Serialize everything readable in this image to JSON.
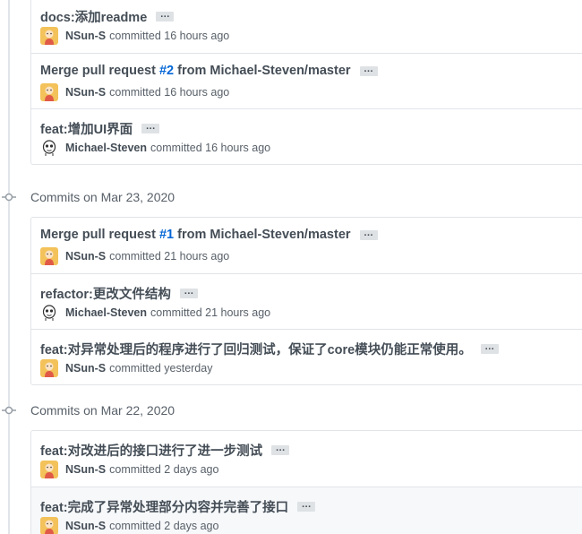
{
  "colors": {
    "accent_link": "#0366d6",
    "text_primary": "#444d56",
    "text_muted": "#586069",
    "border": "#e1e4e8",
    "ellipsis_bg": "#dfe2e5",
    "avatar_nsun_bg": "#f3c25a"
  },
  "groups": [
    {
      "title": "",
      "commits": [
        {
          "title_prefix": "docs:添加readme",
          "pr": "",
          "title_suffix": "",
          "author": "NSun-S",
          "avatar": "nsun-avatar",
          "time": "committed 16 hours ago"
        },
        {
          "title_prefix": "Merge pull request ",
          "pr": "#2",
          "title_suffix": " from Michael-Steven/master",
          "author": "NSun-S",
          "avatar": "nsun-avatar",
          "time": "committed 16 hours ago"
        },
        {
          "title_prefix": "feat:增加UI界面",
          "pr": "",
          "title_suffix": "",
          "author": "Michael-Steven",
          "avatar": "michael-avatar",
          "time": "committed 16 hours ago"
        }
      ]
    },
    {
      "title": "Commits on Mar 23, 2020",
      "commits": [
        {
          "title_prefix": "Merge pull request ",
          "pr": "#1",
          "title_suffix": " from Michael-Steven/master",
          "author": "NSun-S",
          "avatar": "nsun-avatar",
          "time": "committed 21 hours ago"
        },
        {
          "title_prefix": "refactor:更改文件结构",
          "pr": "",
          "title_suffix": "",
          "author": "Michael-Steven",
          "avatar": "michael-avatar",
          "time": "committed 21 hours ago"
        },
        {
          "title_prefix": "feat:对异常处理后的程序进行了回归测试，保证了core模块仍能正常使用。",
          "pr": "",
          "title_suffix": "",
          "author": "NSun-S",
          "avatar": "nsun-avatar",
          "time": "committed yesterday"
        }
      ]
    },
    {
      "title": "Commits on Mar 22, 2020",
      "commits": [
        {
          "title_prefix": "feat:对改进后的接口进行了进一步测试",
          "pr": "",
          "title_suffix": "",
          "author": "NSun-S",
          "avatar": "nsun-avatar",
          "time": "committed 2 days ago"
        },
        {
          "title_prefix": "feat:完成了异常处理部分内容并完善了接口",
          "pr": "",
          "title_suffix": "",
          "author": "NSun-S",
          "avatar": "nsun-avatar",
          "time": "committed 2 days ago"
        }
      ]
    }
  ],
  "ellipsis_label": "…"
}
